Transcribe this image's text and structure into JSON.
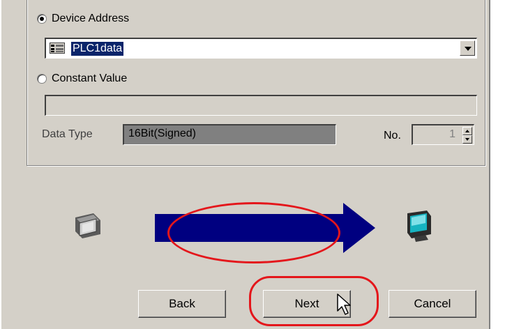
{
  "window": {
    "background": "#d4d0c8"
  },
  "source_group": {
    "device_address_label": "Device Address",
    "device_address_selected": true,
    "device_address_value": "PLC1data",
    "constant_value_label": "Constant Value",
    "constant_value_selected": false,
    "constant_value_value": "",
    "data_type_label": "Data Type",
    "data_type_value": "16Bit(Signed)",
    "no_label": "No.",
    "no_value": "1"
  },
  "transfer_diagram": {
    "source_icon": "panel-display-icon",
    "target_icon": "monitor-icon",
    "arrow_color": "#000080",
    "highlight_color": "#e4161b"
  },
  "footer": {
    "back_label": "Back",
    "next_label": "Next",
    "cancel_label": "Cancel"
  }
}
